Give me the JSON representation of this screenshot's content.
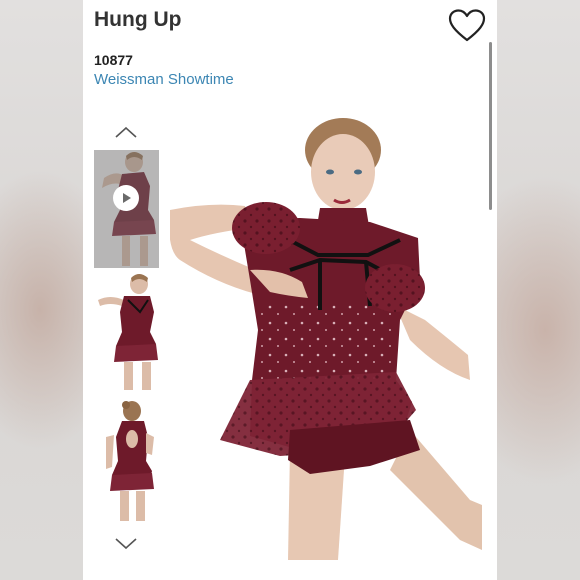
{
  "product": {
    "title": "Hung Up",
    "sku": "10877",
    "brand": "Weissman Showtime"
  },
  "icons": {
    "favorite": "heart-outline-icon",
    "prev": "chevron-up-icon",
    "next": "chevron-down-icon",
    "video": "play-icon"
  },
  "colors": {
    "title": "#333333",
    "brand_link": "#3c86b3",
    "costume": "#6e1a2a"
  },
  "gallery": {
    "thumbnails": [
      {
        "kind": "video",
        "view": "front-pose"
      },
      {
        "kind": "image",
        "view": "front"
      },
      {
        "kind": "image",
        "view": "back"
      }
    ],
    "selected_index": 0
  }
}
